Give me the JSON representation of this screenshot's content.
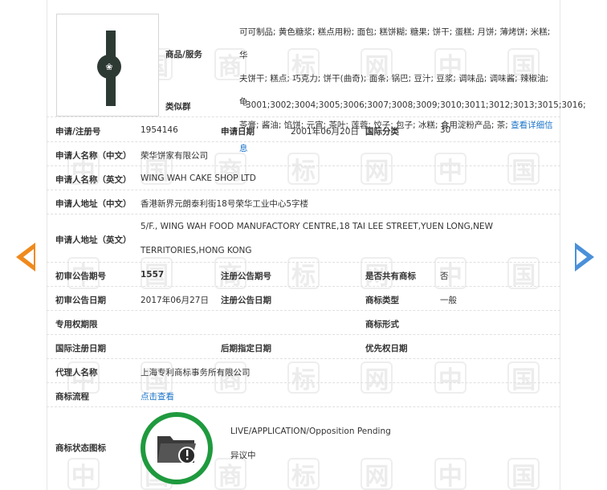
{
  "goods": {
    "label": "商品/服务",
    "lines": [
      "可可制品; 黄色糖浆; 糕点用粉; 面包; 糕饼糊; 糖果; 饼干; 蛋糕; 月饼; 薄烤饼; 米糕; 华",
      "夫饼干; 糕点; 巧克力; 饼干(曲奇); 面条; 锅巴; 豆汁; 豆浆; 调味品; 调味酱; 辣椒油; 龟",
      "苓膏; 酱油; 馅饼; 元宵; 茶叶; 莲蓉; 饺子; 包子; 冰糕; 食用淀粉产品; 茶;"
    ],
    "detail_link": "查看详细信息"
  },
  "similar_group": {
    "label": "类似群",
    "value": "3001;3002;3004;3005;3006;3007;3008;3009;3010;3011;3012;3013;3015;3016;"
  },
  "reg_no": {
    "label": "申请/注册号",
    "value": "1954146"
  },
  "apply_date": {
    "label": "申请日期",
    "value": "2001年06月20日"
  },
  "intl_class": {
    "label": "国际分类",
    "value": "30"
  },
  "applicant_cn": {
    "label": "申请人名称（中文）",
    "value": "荣华饼家有限公司"
  },
  "applicant_en": {
    "label": "申请人名称（英文）",
    "value": "WING WAH CAKE SHOP LTD"
  },
  "address_cn": {
    "label": "申请人地址（中文）",
    "value": "香港新界元朗泰利街18号荣华工业中心5字楼"
  },
  "address_en": {
    "label": "申请人地址（英文）",
    "line1": "5/F., WING WAH FOOD MANUFACTORY CENTRE,18 TAI LEE STREET,YUEN LONG,NEW",
    "line2": "TERRITORIES,HONG KONG"
  },
  "prelim_no": {
    "label": "初审公告期号",
    "value": "1557"
  },
  "reg_notice_no": {
    "label": "注册公告期号",
    "value": ""
  },
  "shared": {
    "label": "是否共有商标",
    "value": "否"
  },
  "prelim_date": {
    "label": "初审公告日期",
    "value": "2017年06月27日"
  },
  "reg_notice_date": {
    "label": "注册公告日期",
    "value": ""
  },
  "tm_type": {
    "label": "商标类型",
    "value": "一般"
  },
  "exclusive_period": {
    "label": "专用权期限",
    "value": ""
  },
  "tm_form": {
    "label": "商标形式",
    "value": ""
  },
  "intl_reg_date": {
    "label": "国际注册日期",
    "value": ""
  },
  "later_date": {
    "label": "后期指定日期",
    "value": ""
  },
  "priority_date": {
    "label": "优先权日期",
    "value": ""
  },
  "agent": {
    "label": "代理人名称",
    "value": "上海专利商标事务所有限公司"
  },
  "process": {
    "label": "商标流程",
    "link": "点击查看"
  },
  "status": {
    "label": "商标状态图标",
    "en": "LIVE/APPLICATION/Opposition Pending",
    "cn": "异议中"
  },
  "colors": {
    "accent_link": "#1a73c8",
    "status_ring": "#1f9a3e",
    "arrow_prev": "#f08a1c",
    "arrow_next": "#4a90d9"
  },
  "icons": [
    "folder-alert-icon",
    "prev-arrow-icon",
    "next-arrow-icon"
  ]
}
